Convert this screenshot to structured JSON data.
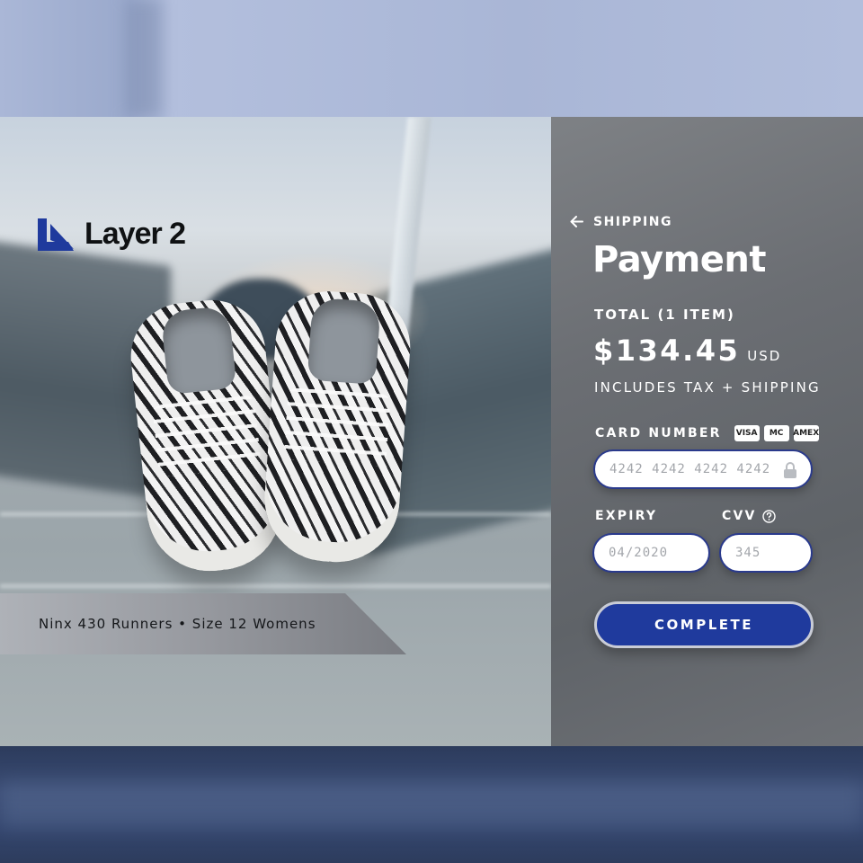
{
  "brand": {
    "name": "Layer 2",
    "logo_icon": "layer2-logo-icon",
    "color": "#1f3a9d"
  },
  "product": {
    "caption": "Ninx 430 Runners • Size 12 Womens"
  },
  "checkout": {
    "back_label": "SHIPPING",
    "back_icon": "arrow-left-icon",
    "title": "Payment",
    "total_label": "TOTAL (1 ITEM)",
    "total_amount": "$134.45",
    "currency": "USD",
    "tax_note": "INCLUDES TAX + SHIPPING",
    "card_number": {
      "label": "CARD NUMBER",
      "placeholder": "4242 4242 4242 4242",
      "accepted_cards": [
        "VISA",
        "MC",
        "AMEX"
      ]
    },
    "expiry": {
      "label": "EXPIRY",
      "placeholder": "04/2020"
    },
    "cvv": {
      "label": "CVV",
      "placeholder": "345"
    },
    "submit_label": "COMPLETE"
  },
  "colors": {
    "accent": "#1f3a9d",
    "input_border": "#2a3a8c",
    "panel": "#6b6e73"
  }
}
